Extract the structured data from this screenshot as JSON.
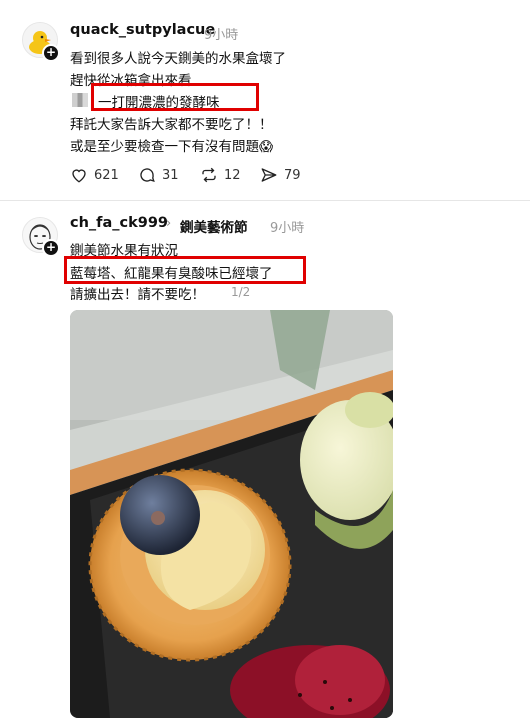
{
  "posts": [
    {
      "username": "quack_sutpylacue",
      "time": "9小時",
      "lines": [
        "看到很多人說今天鍘美的水果盒壞了",
        "趕快從冰箱拿出來看",
        "一打開濃濃的發酵味",
        "拜託大家告訴大家都不要吃了！！",
        "或是至少要檢查一下有沒有問題😱"
      ],
      "stats": {
        "likes": "621",
        "comments": "31",
        "reposts": "12",
        "shares": "79"
      }
    },
    {
      "username": "ch_fa_ck999",
      "community": "鍘美藝術節",
      "time": "9小時",
      "lines": [
        "鍘美節水果有狀況",
        "藍莓塔、紅龍果有臭酸味已經壞了",
        "請擴出去！請不要吃！"
      ],
      "pager": "1/2"
    }
  ],
  "icons": {
    "like": "heart-icon",
    "comment": "comment-icon",
    "repost": "repost-icon",
    "share": "share-icon",
    "follow": "plus-icon",
    "chevron": "chevron-right-icon"
  },
  "colors": {
    "highlight": "#e00000",
    "muted": "#999999"
  }
}
